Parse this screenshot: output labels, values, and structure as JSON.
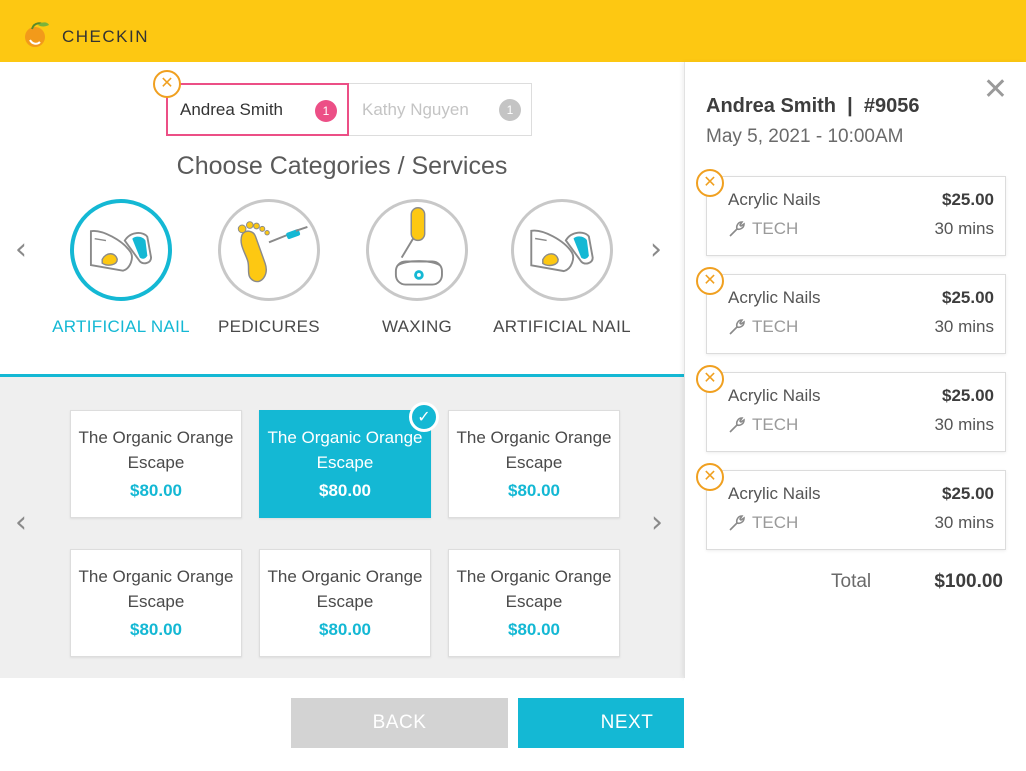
{
  "app": {
    "brand": "CHECKIN"
  },
  "customers": [
    {
      "name": "Andrea Smith",
      "count": "1",
      "active": true
    },
    {
      "name": "Kathy Nguyen",
      "count": "1",
      "active": false
    }
  ],
  "section_title": "Choose Categories / Services",
  "categories": [
    {
      "label": "ARTIFICIAL NAIL",
      "icon": "artificial-nail-icon",
      "active": true
    },
    {
      "label": "PEDICURES",
      "icon": "pedicure-foot-icon",
      "active": false
    },
    {
      "label": "WAXING",
      "icon": "waxing-icon",
      "active": false
    },
    {
      "label": "ARTIFICIAL NAIL",
      "icon": "artificial-nail-icon",
      "active": false
    }
  ],
  "services": [
    {
      "name": "The Organic Orange Escape",
      "price": "$80.00",
      "selected": false
    },
    {
      "name": "The Organic Orange Escape",
      "price": "$80.00",
      "selected": true
    },
    {
      "name": "The Organic Orange Escape",
      "price": "$80.00",
      "selected": false
    },
    {
      "name": "The Organic Orange Escape",
      "price": "$80.00",
      "selected": false
    },
    {
      "name": "The Organic Orange Escape",
      "price": "$80.00",
      "selected": false
    },
    {
      "name": "The Organic Orange Escape",
      "price": "$80.00",
      "selected": false
    }
  ],
  "buttons": {
    "back": "BACK",
    "next": "NEXT"
  },
  "summary": {
    "title": "Andrea Smith  |  #9056",
    "datetime": "May 5, 2021 - 10:00AM",
    "items": [
      {
        "name": "Acrylic Nails",
        "price": "$25.00",
        "tech": "TECH",
        "duration": "30 mins"
      },
      {
        "name": "Acrylic Nails",
        "price": "$25.00",
        "tech": "TECH",
        "duration": "30 mins"
      },
      {
        "name": "Acrylic Nails",
        "price": "$25.00",
        "tech": "TECH",
        "duration": "30 mins"
      },
      {
        "name": "Acrylic Nails",
        "price": "$25.00",
        "tech": "TECH",
        "duration": "30 mins"
      }
    ],
    "total_label": "Total",
    "total_value": "$100.00"
  },
  "colors": {
    "accent": "#14b8d4",
    "header": "#fdc812",
    "pink": "#ec4f86",
    "orange": "#f0a020"
  }
}
